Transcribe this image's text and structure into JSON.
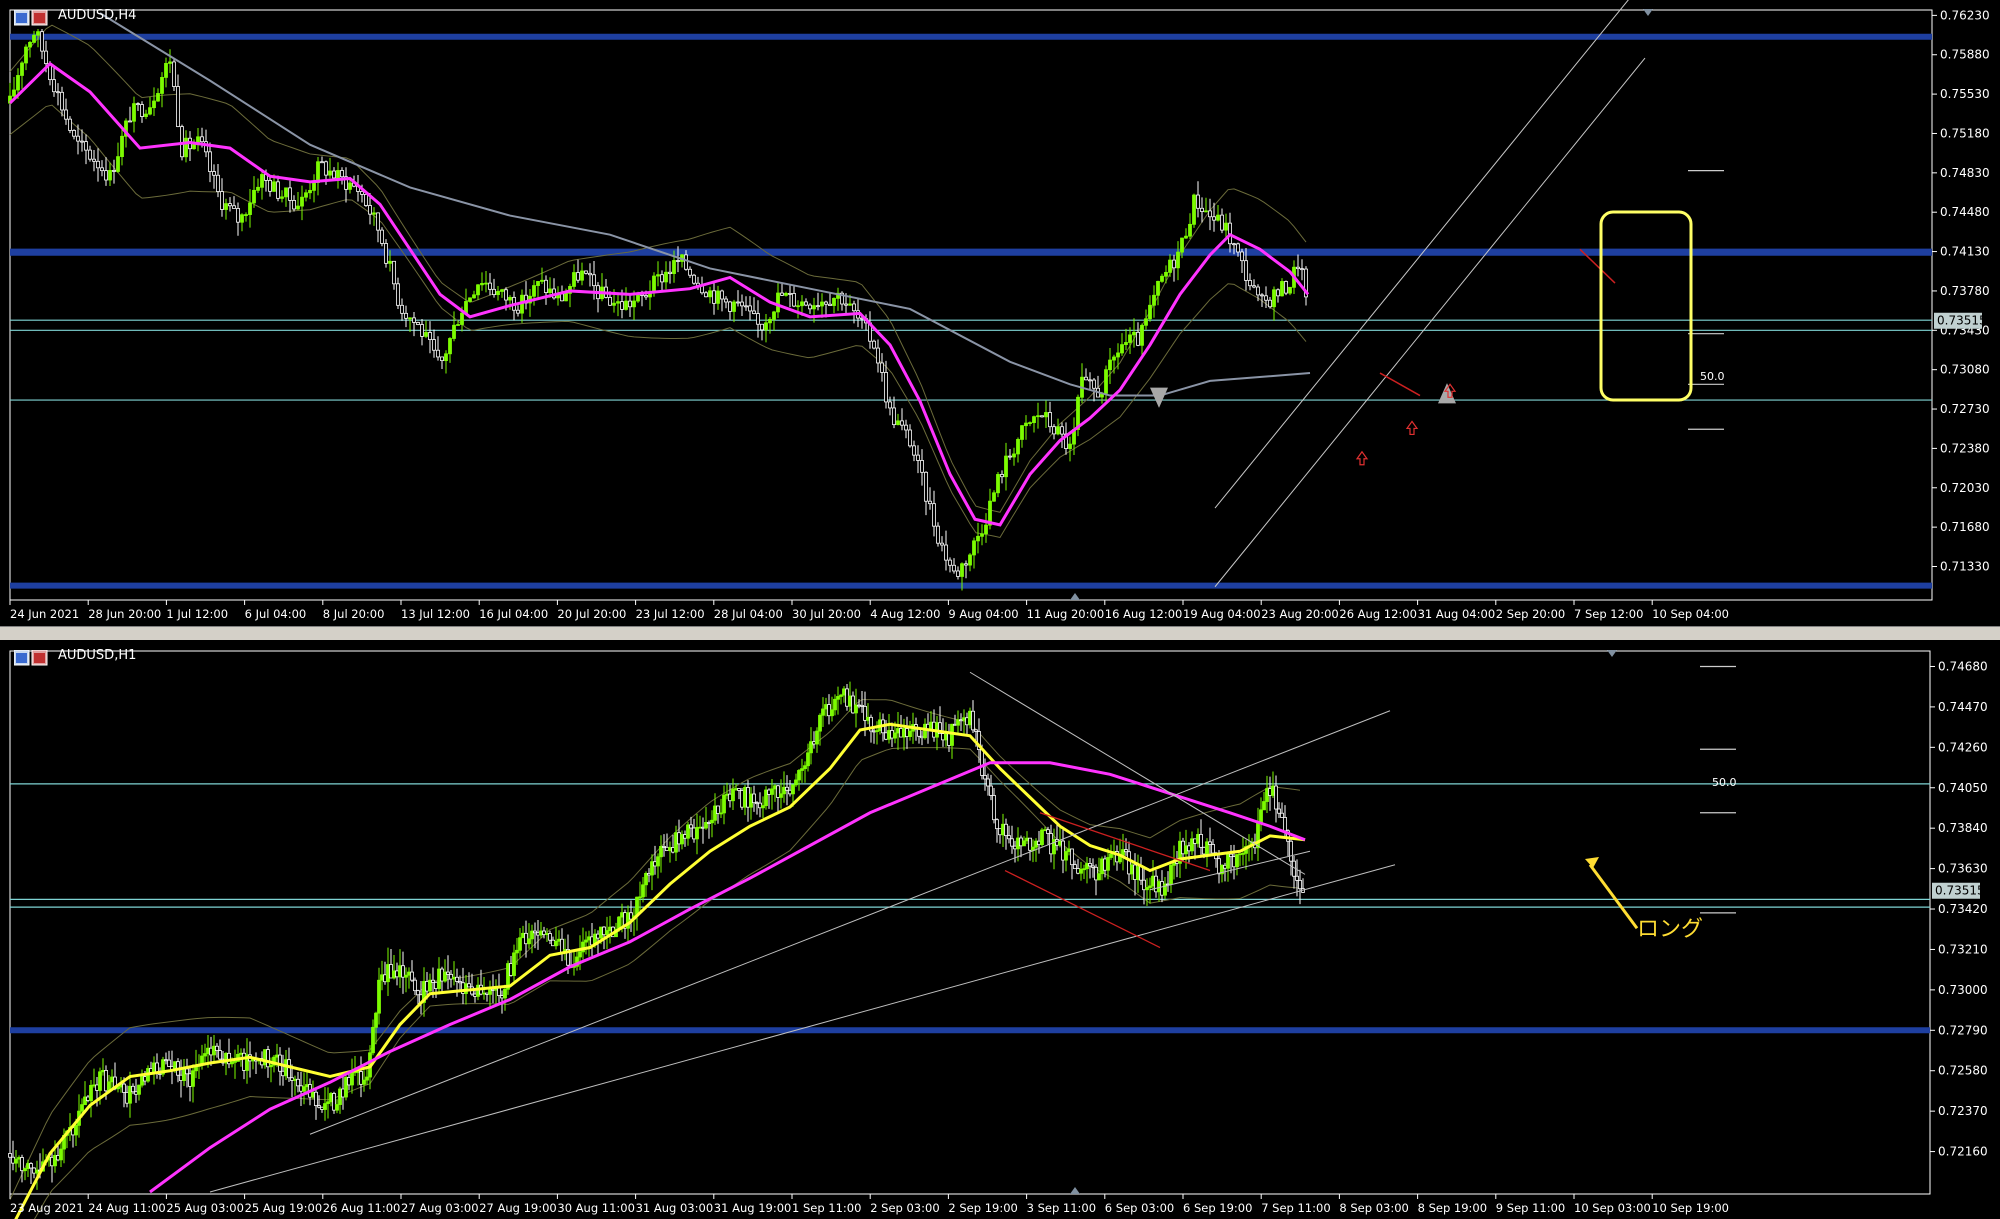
{
  "colors": {
    "background": "#000000",
    "bull_candle": "#7cfc00",
    "bear_candle": "#ffffff",
    "ma_fast": "#ff33ff",
    "ma_slow": "#8a94a6",
    "ma_h1_fast": "#ffff33",
    "bollinger": "#6b6b3a",
    "sr_thick": "#1e3fa0",
    "level_thin": "#7fd4d4",
    "highlight_box": "#ffff66",
    "price_tag": "#c0d0d0"
  },
  "chart_data": [
    {
      "type": "candlestick",
      "window_title": "AUDUSD,H4",
      "symbol": "AUDUSD",
      "timeframe": "H4",
      "ylim": [
        0.7105,
        0.7626
      ],
      "y_ticks": [
        "0.76230",
        "0.75880",
        "0.75530",
        "0.75180",
        "0.74830",
        "0.74480",
        "0.74130",
        "0.73780",
        "0.73430",
        "0.73080",
        "0.72730",
        "0.72380",
        "0.72030",
        "0.71680",
        "0.71330"
      ],
      "x_ticks": [
        "24 Jun 2021",
        "28 Jun 20:00",
        "1 Jul 12:00",
        "6 Jul 04:00",
        "8 Jul 20:00",
        "13 Jul 12:00",
        "16 Jul 04:00",
        "20 Jul 20:00",
        "23 Jul 12:00",
        "28 Jul 04:00",
        "30 Jul 20:00",
        "4 Aug 12:00",
        "9 Aug 04:00",
        "11 Aug 20:00",
        "16 Aug 12:00",
        "19 Aug 04:00",
        "23 Aug 20:00",
        "26 Aug 12:00",
        "31 Aug 04:00",
        "2 Sep 20:00",
        "7 Sep 12:00",
        "10 Sep 04:00"
      ],
      "price_tag": "0.73515",
      "fib_label": "50.0",
      "close_path": [
        [
          0,
          0.7545
        ],
        [
          15,
          0.7595
        ],
        [
          25,
          0.761
        ],
        [
          45,
          0.756
        ],
        [
          65,
          0.751
        ],
        [
          85,
          0.7495
        ],
        [
          100,
          0.748
        ],
        [
          120,
          0.7535
        ],
        [
          140,
          0.7545
        ],
        [
          160,
          0.7585
        ],
        [
          172,
          0.7505
        ],
        [
          190,
          0.751
        ],
        [
          210,
          0.746
        ],
        [
          230,
          0.744
        ],
        [
          250,
          0.748
        ],
        [
          270,
          0.7465
        ],
        [
          290,
          0.7455
        ],
        [
          310,
          0.749
        ],
        [
          330,
          0.7478
        ],
        [
          350,
          0.7468
        ],
        [
          370,
          0.743
        ],
        [
          390,
          0.7365
        ],
        [
          410,
          0.7345
        ],
        [
          430,
          0.731
        ],
        [
          450,
          0.736
        ],
        [
          470,
          0.739
        ],
        [
          490,
          0.7375
        ],
        [
          510,
          0.7365
        ],
        [
          530,
          0.7385
        ],
        [
          550,
          0.737
        ],
        [
          570,
          0.7395
        ],
        [
          590,
          0.7375
        ],
        [
          610,
          0.7365
        ],
        [
          630,
          0.737
        ],
        [
          650,
          0.739
        ],
        [
          670,
          0.7405
        ],
        [
          690,
          0.7385
        ],
        [
          710,
          0.737
        ],
        [
          730,
          0.7365
        ],
        [
          750,
          0.7345
        ],
        [
          770,
          0.7375
        ],
        [
          790,
          0.7368
        ],
        [
          810,
          0.737
        ],
        [
          830,
          0.7375
        ],
        [
          850,
          0.735
        ],
        [
          865,
          0.733
        ],
        [
          880,
          0.727
        ],
        [
          900,
          0.7245
        ],
        [
          915,
          0.72
        ],
        [
          930,
          0.7155
        ],
        [
          945,
          0.7125
        ],
        [
          960,
          0.7145
        ],
        [
          975,
          0.7175
        ],
        [
          990,
          0.7215
        ],
        [
          1010,
          0.725
        ],
        [
          1030,
          0.727
        ],
        [
          1050,
          0.725
        ],
        [
          1062,
          0.7235
        ],
        [
          1070,
          0.7295
        ],
        [
          1090,
          0.7288
        ],
        [
          1110,
          0.733
        ],
        [
          1130,
          0.7335
        ],
        [
          1150,
          0.7385
        ],
        [
          1170,
          0.7415
        ],
        [
          1185,
          0.746
        ],
        [
          1200,
          0.7445
        ],
        [
          1215,
          0.7435
        ],
        [
          1230,
          0.7405
        ],
        [
          1250,
          0.7365
        ],
        [
          1265,
          0.7375
        ],
        [
          1280,
          0.7385
        ],
        [
          1290,
          0.7408
        ],
        [
          1298,
          0.7352
        ]
      ],
      "ma_fast_path": [
        [
          0,
          0.7545
        ],
        [
          40,
          0.758
        ],
        [
          80,
          0.7555
        ],
        [
          130,
          0.7505
        ],
        [
          180,
          0.751
        ],
        [
          220,
          0.7505
        ],
        [
          260,
          0.748
        ],
        [
          300,
          0.7475
        ],
        [
          340,
          0.7478
        ],
        [
          370,
          0.7455
        ],
        [
          400,
          0.7415
        ],
        [
          430,
          0.7375
        ],
        [
          460,
          0.7355
        ],
        [
          500,
          0.7365
        ],
        [
          560,
          0.7378
        ],
        [
          620,
          0.7375
        ],
        [
          680,
          0.738
        ],
        [
          720,
          0.739
        ],
        [
          760,
          0.7368
        ],
        [
          800,
          0.7355
        ],
        [
          850,
          0.7358
        ],
        [
          880,
          0.733
        ],
        [
          910,
          0.728
        ],
        [
          940,
          0.7215
        ],
        [
          965,
          0.7175
        ],
        [
          990,
          0.717
        ],
        [
          1020,
          0.7215
        ],
        [
          1050,
          0.7245
        ],
        [
          1080,
          0.7265
        ],
        [
          1110,
          0.729
        ],
        [
          1140,
          0.733
        ],
        [
          1170,
          0.7375
        ],
        [
          1200,
          0.741
        ],
        [
          1220,
          0.7428
        ],
        [
          1250,
          0.7415
        ],
        [
          1280,
          0.7395
        ],
        [
          1298,
          0.7375
        ]
      ],
      "ma_slow_path": [
        [
          90,
          0.7625
        ],
        [
          200,
          0.7565
        ],
        [
          300,
          0.7508
        ],
        [
          400,
          0.747
        ],
        [
          500,
          0.7445
        ],
        [
          600,
          0.7428
        ],
        [
          700,
          0.7398
        ],
        [
          800,
          0.738
        ],
        [
          900,
          0.7362
        ],
        [
          1000,
          0.7315
        ],
        [
          1060,
          0.7295
        ],
        [
          1100,
          0.7285
        ],
        [
          1150,
          0.7285
        ],
        [
          1200,
          0.7298
        ],
        [
          1300,
          0.7305
        ]
      ],
      "thick_levels": [
        0.7604,
        0.7413,
        0.7412,
        0.7116
      ],
      "thin_levels": [
        0.7352,
        0.7343,
        0.7281
      ],
      "fib_levels": [
        0.7485,
        0.734,
        0.7295,
        0.7255
      ],
      "annotations": [
        "sell-arrow",
        "buy-arrow",
        "highlight-box"
      ]
    },
    {
      "type": "candlestick",
      "window_title": "AUDUSD,H1",
      "symbol": "AUDUSD",
      "timeframe": "H1",
      "ylim": [
        0.7195,
        0.7475
      ],
      "y_ticks": [
        "0.74680",
        "0.74470",
        "0.74260",
        "0.74050",
        "0.73840",
        "0.73630",
        "0.73420",
        "0.73210",
        "0.73000",
        "0.72790",
        "0.72580",
        "0.72370",
        "0.72160"
      ],
      "x_ticks": [
        "23 Aug 2021",
        "24 Aug 11:00",
        "25 Aug 03:00",
        "25 Aug 19:00",
        "26 Aug 11:00",
        "27 Aug 03:00",
        "27 Aug 19:00",
        "30 Aug 11:00",
        "31 Aug 03:00",
        "31 Aug 19:00",
        "1 Sep 11:00",
        "2 Sep 03:00",
        "2 Sep 19:00",
        "3 Sep 11:00",
        "6 Sep 03:00",
        "6 Sep 19:00",
        "7 Sep 11:00",
        "8 Sep 03:00",
        "8 Sep 19:00",
        "9 Sep 11:00",
        "10 Sep 03:00",
        "10 Sep 19:00"
      ],
      "price_tag": "0.73515",
      "fib_label": "50.0",
      "annotation_text": "ロング",
      "close_path": [
        [
          0,
          0.7215
        ],
        [
          30,
          0.7205
        ],
        [
          60,
          0.7225
        ],
        [
          90,
          0.7255
        ],
        [
          120,
          0.7245
        ],
        [
          150,
          0.726
        ],
        [
          180,
          0.7255
        ],
        [
          200,
          0.7272
        ],
        [
          220,
          0.7262
        ],
        [
          250,
          0.7265
        ],
        [
          280,
          0.7258
        ],
        [
          300,
          0.7245
        ],
        [
          320,
          0.724
        ],
        [
          340,
          0.7255
        ],
        [
          355,
          0.725
        ],
        [
          370,
          0.7305
        ],
        [
          390,
          0.7312
        ],
        [
          410,
          0.7298
        ],
        [
          430,
          0.7308
        ],
        [
          460,
          0.7302
        ],
        [
          490,
          0.7298
        ],
        [
          510,
          0.7325
        ],
        [
          530,
          0.7332
        ],
        [
          560,
          0.7315
        ],
        [
          590,
          0.7328
        ],
        [
          620,
          0.7338
        ],
        [
          640,
          0.7362
        ],
        [
          660,
          0.7375
        ],
        [
          690,
          0.7385
        ],
        [
          720,
          0.7402
        ],
        [
          750,
          0.7398
        ],
        [
          780,
          0.7405
        ],
        [
          800,
          0.7425
        ],
        [
          815,
          0.7445
        ],
        [
          830,
          0.7455
        ],
        [
          845,
          0.7445
        ],
        [
          860,
          0.744
        ],
        [
          880,
          0.7432
        ],
        [
          910,
          0.7435
        ],
        [
          940,
          0.7432
        ],
        [
          960,
          0.7445
        ],
        [
          975,
          0.7405
        ],
        [
          990,
          0.7385
        ],
        [
          1010,
          0.7375
        ],
        [
          1030,
          0.738
        ],
        [
          1050,
          0.7372
        ],
        [
          1070,
          0.7365
        ],
        [
          1090,
          0.7362
        ],
        [
          1110,
          0.737
        ],
        [
          1130,
          0.7358
        ],
        [
          1150,
          0.7352
        ],
        [
          1170,
          0.7372
        ],
        [
          1190,
          0.7378
        ],
        [
          1210,
          0.7365
        ],
        [
          1230,
          0.7368
        ],
        [
          1245,
          0.7375
        ],
        [
          1258,
          0.7405
        ],
        [
          1270,
          0.7395
        ],
        [
          1282,
          0.7365
        ],
        [
          1295,
          0.7351
        ]
      ],
      "ma_fast_path": [
        [
          0,
          0.7175
        ],
        [
          40,
          0.7215
        ],
        [
          80,
          0.724
        ],
        [
          120,
          0.7255
        ],
        [
          160,
          0.7258
        ],
        [
          200,
          0.7262
        ],
        [
          240,
          0.7265
        ],
        [
          280,
          0.726
        ],
        [
          320,
          0.7255
        ],
        [
          360,
          0.726
        ],
        [
          390,
          0.7282
        ],
        [
          420,
          0.7298
        ],
        [
          460,
          0.73
        ],
        [
          500,
          0.7302
        ],
        [
          540,
          0.7318
        ],
        [
          580,
          0.7322
        ],
        [
          620,
          0.7335
        ],
        [
          660,
          0.7355
        ],
        [
          700,
          0.7372
        ],
        [
          740,
          0.7385
        ],
        [
          780,
          0.7395
        ],
        [
          820,
          0.7415
        ],
        [
          850,
          0.7435
        ],
        [
          880,
          0.7438
        ],
        [
          920,
          0.7435
        ],
        [
          960,
          0.7432
        ],
        [
          990,
          0.7415
        ],
        [
          1020,
          0.74
        ],
        [
          1050,
          0.7385
        ],
        [
          1080,
          0.7375
        ],
        [
          1110,
          0.737
        ],
        [
          1140,
          0.7362
        ],
        [
          1170,
          0.7368
        ],
        [
          1200,
          0.737
        ],
        [
          1230,
          0.7372
        ],
        [
          1260,
          0.738
        ],
        [
          1295,
          0.7378
        ]
      ],
      "ma_slow_path": [
        [
          140,
          0.7195
        ],
        [
          200,
          0.7218
        ],
        [
          260,
          0.7238
        ],
        [
          320,
          0.7252
        ],
        [
          380,
          0.7268
        ],
        [
          440,
          0.7282
        ],
        [
          500,
          0.7295
        ],
        [
          560,
          0.7312
        ],
        [
          620,
          0.7325
        ],
        [
          680,
          0.7342
        ],
        [
          740,
          0.7358
        ],
        [
          800,
          0.7375
        ],
        [
          860,
          0.7392
        ],
        [
          920,
          0.7405
        ],
        [
          980,
          0.7418
        ],
        [
          1040,
          0.7418
        ],
        [
          1100,
          0.7412
        ],
        [
          1160,
          0.7402
        ],
        [
          1220,
          0.7392
        ],
        [
          1260,
          0.7385
        ],
        [
          1295,
          0.7378
        ]
      ],
      "thick_levels": [
        0.7279
      ],
      "thin_levels": [
        0.7407,
        0.7347,
        0.7343
      ],
      "fib_levels": [
        0.7468,
        0.7425,
        0.7392,
        0.734
      ],
      "annotations": [
        "long-arrow"
      ]
    }
  ]
}
